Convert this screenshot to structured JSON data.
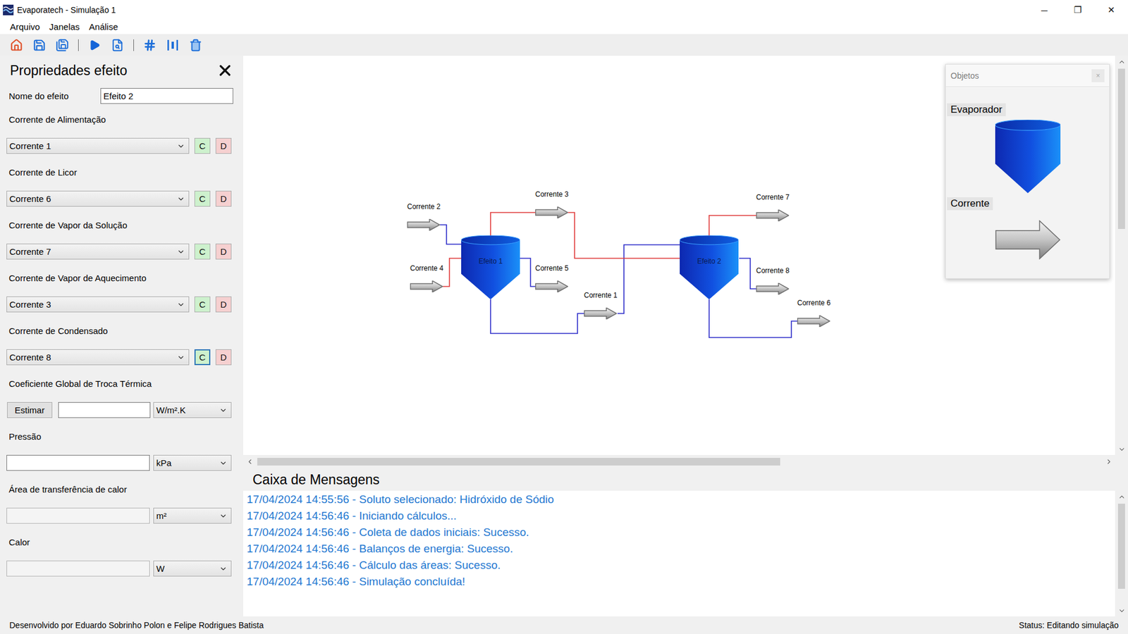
{
  "window": {
    "title": "Evaporatech - Simulação 1",
    "controls": [
      "─",
      "❐",
      "✕"
    ]
  },
  "menu": [
    {
      "label": "Arquivo"
    },
    {
      "label": "Janelas"
    },
    {
      "label": "Análise"
    }
  ],
  "properties": {
    "title": "Propriedades efeito",
    "name": {
      "label": "Nome do efeito",
      "value": "Efeito 2"
    },
    "streams": [
      {
        "label": "Corrente de Alimentação",
        "value": "Corrente 1",
        "connect": "C",
        "disconnect": "D",
        "focused": false
      },
      {
        "label": "Corrente de Licor",
        "value": "Corrente 6",
        "connect": "C",
        "disconnect": "D",
        "focused": false
      },
      {
        "label": "Corrente de Vapor da Solução",
        "value": "Corrente 7",
        "connect": "C",
        "disconnect": "D",
        "focused": false
      },
      {
        "label": "Corrente de Vapor de Aquecimento",
        "value": "Corrente 3",
        "connect": "C",
        "disconnect": "D",
        "focused": false
      },
      {
        "label": "Corrente de Condensado",
        "value": "Corrente 8",
        "connect": "C",
        "disconnect": "D",
        "focused": true
      }
    ],
    "quantities": [
      {
        "kind": "estimate",
        "label": "Coeficiente Global de Troca Térmica",
        "button": "Estimar",
        "value": "",
        "unit": "W/m².K",
        "disabled": false
      },
      {
        "kind": "input",
        "label": "Pressão",
        "value": "",
        "unit": "kPa",
        "disabled": false
      },
      {
        "kind": "input",
        "label": "Área de transferência de calor",
        "value": "",
        "unit": "m²",
        "disabled": true
      },
      {
        "kind": "input",
        "label": "Calor",
        "value": "",
        "unit": "W",
        "disabled": true
      }
    ]
  },
  "diagram": {
    "effects": [
      {
        "label": "Efeito 1"
      },
      {
        "label": "Efeito 2"
      }
    ],
    "streams": [
      {
        "label": "Corrente 2"
      },
      {
        "label": "Corrente 4"
      },
      {
        "label": "Corrente 3"
      },
      {
        "label": "Corrente 5"
      },
      {
        "label": "Corrente 1"
      },
      {
        "label": "Corrente 7"
      },
      {
        "label": "Corrente 8"
      },
      {
        "label": "Corrente 6"
      }
    ],
    "connections": [
      {
        "color": "#2b2bc9"
      },
      {
        "color": "#2b2bc9"
      },
      {
        "color": "#2b2bc9"
      },
      {
        "color": "#2b2bc9"
      },
      {
        "color": "#2b2bc9"
      },
      {
        "color": "#2b2bc9"
      },
      {
        "color": "#e03a3a"
      },
      {
        "color": "#e03a3a"
      },
      {
        "color": "#e03a3a"
      },
      {
        "color": "#e03a3a"
      }
    ]
  },
  "objects": {
    "title": "Objetos",
    "close": "×",
    "items": [
      {
        "label": "Evaporador",
        "kind": "evaporator"
      },
      {
        "label": "Corrente",
        "kind": "stream"
      }
    ]
  },
  "scrollbars": {
    "canvas_vertical": {
      "level": 0.43
    },
    "canvas_horizontal": {
      "level": 0.62
    },
    "messages_vertical": {
      "level": 0.85
    }
  },
  "messages": {
    "title": "Caixa de Mensagens",
    "lines": [
      "17/04/2024 14:55:56 - Soluto selecionado: Hidróxido de Sódio",
      "17/04/2024 14:56:46 - Iniciando cálculos...",
      "17/04/2024 14:56:46 - Coleta de dados iniciais: Sucesso.",
      "17/04/2024 14:56:46 - Balanços de energia: Sucesso.",
      "17/04/2024 14:56:46 - Cálculo das áreas: Sucesso.",
      "17/04/2024 14:56:46 - Simulação concluída!"
    ]
  },
  "status_bar": {
    "left": "Desenvolvido por Eduardo Sobrinho Polon e Felipe Rodrigues Batista",
    "right": "Status: Editando simulação"
  }
}
